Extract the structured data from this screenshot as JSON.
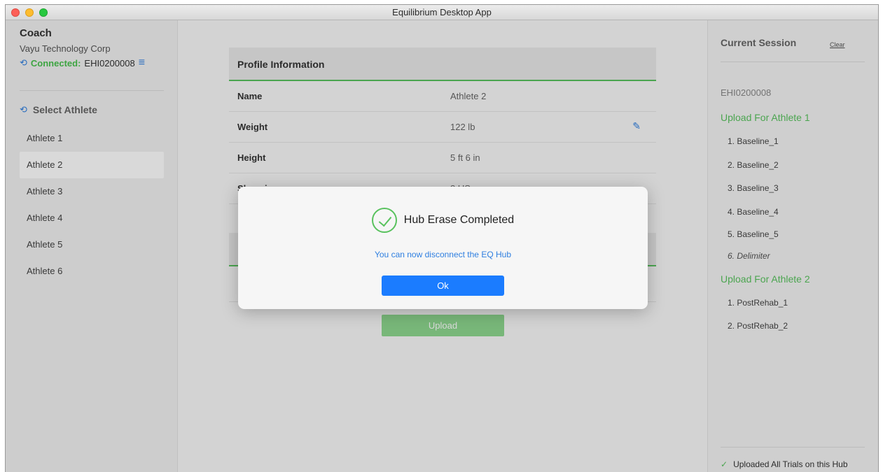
{
  "window": {
    "title": "Equilibrium Desktop App"
  },
  "sidebar": {
    "coach_title": "Coach",
    "org_name": "Vayu Technology Corp",
    "connected_label": "Connected:",
    "hub_id": "EHI0200008",
    "select_athlete_label": "Select Athlete",
    "athletes": [
      "Athlete 1",
      "Athlete 2",
      "Athlete 3",
      "Athlete 4",
      "Athlete 5",
      "Athlete 6"
    ],
    "selected_athlete": "Athlete 2"
  },
  "profile": {
    "header": "Profile Information",
    "rows": [
      {
        "label": "Name",
        "value": "Athlete 2"
      },
      {
        "label": "Weight",
        "value": "122 lb"
      },
      {
        "label": "Height",
        "value": "5 ft 6 in"
      },
      {
        "label": "Shoesize",
        "value": "8 US"
      }
    ]
  },
  "upload_button": "Upload",
  "session": {
    "title": "Current Session",
    "clear_label": "Clear",
    "hub_id": "EHI0200008",
    "groups": [
      {
        "title": "Upload For Athlete 1",
        "trials": [
          "1. Baseline_1",
          "2. Baseline_2",
          "3. Baseline_3",
          "4. Baseline_4",
          "5. Baseline_5",
          "6. Delimiter"
        ]
      },
      {
        "title": "Upload For Athlete 2",
        "trials": [
          "1. PostRehab_1",
          "2. PostRehab_2"
        ]
      }
    ],
    "footer": "Uploaded All Trials on this Hub"
  },
  "dialog": {
    "title": "Hub Erase Completed",
    "message": "You can now disconnect the EQ Hub",
    "ok_label": "Ok"
  },
  "colors": {
    "accent_green": "#59c25e",
    "accent_blue": "#1b7cff"
  }
}
